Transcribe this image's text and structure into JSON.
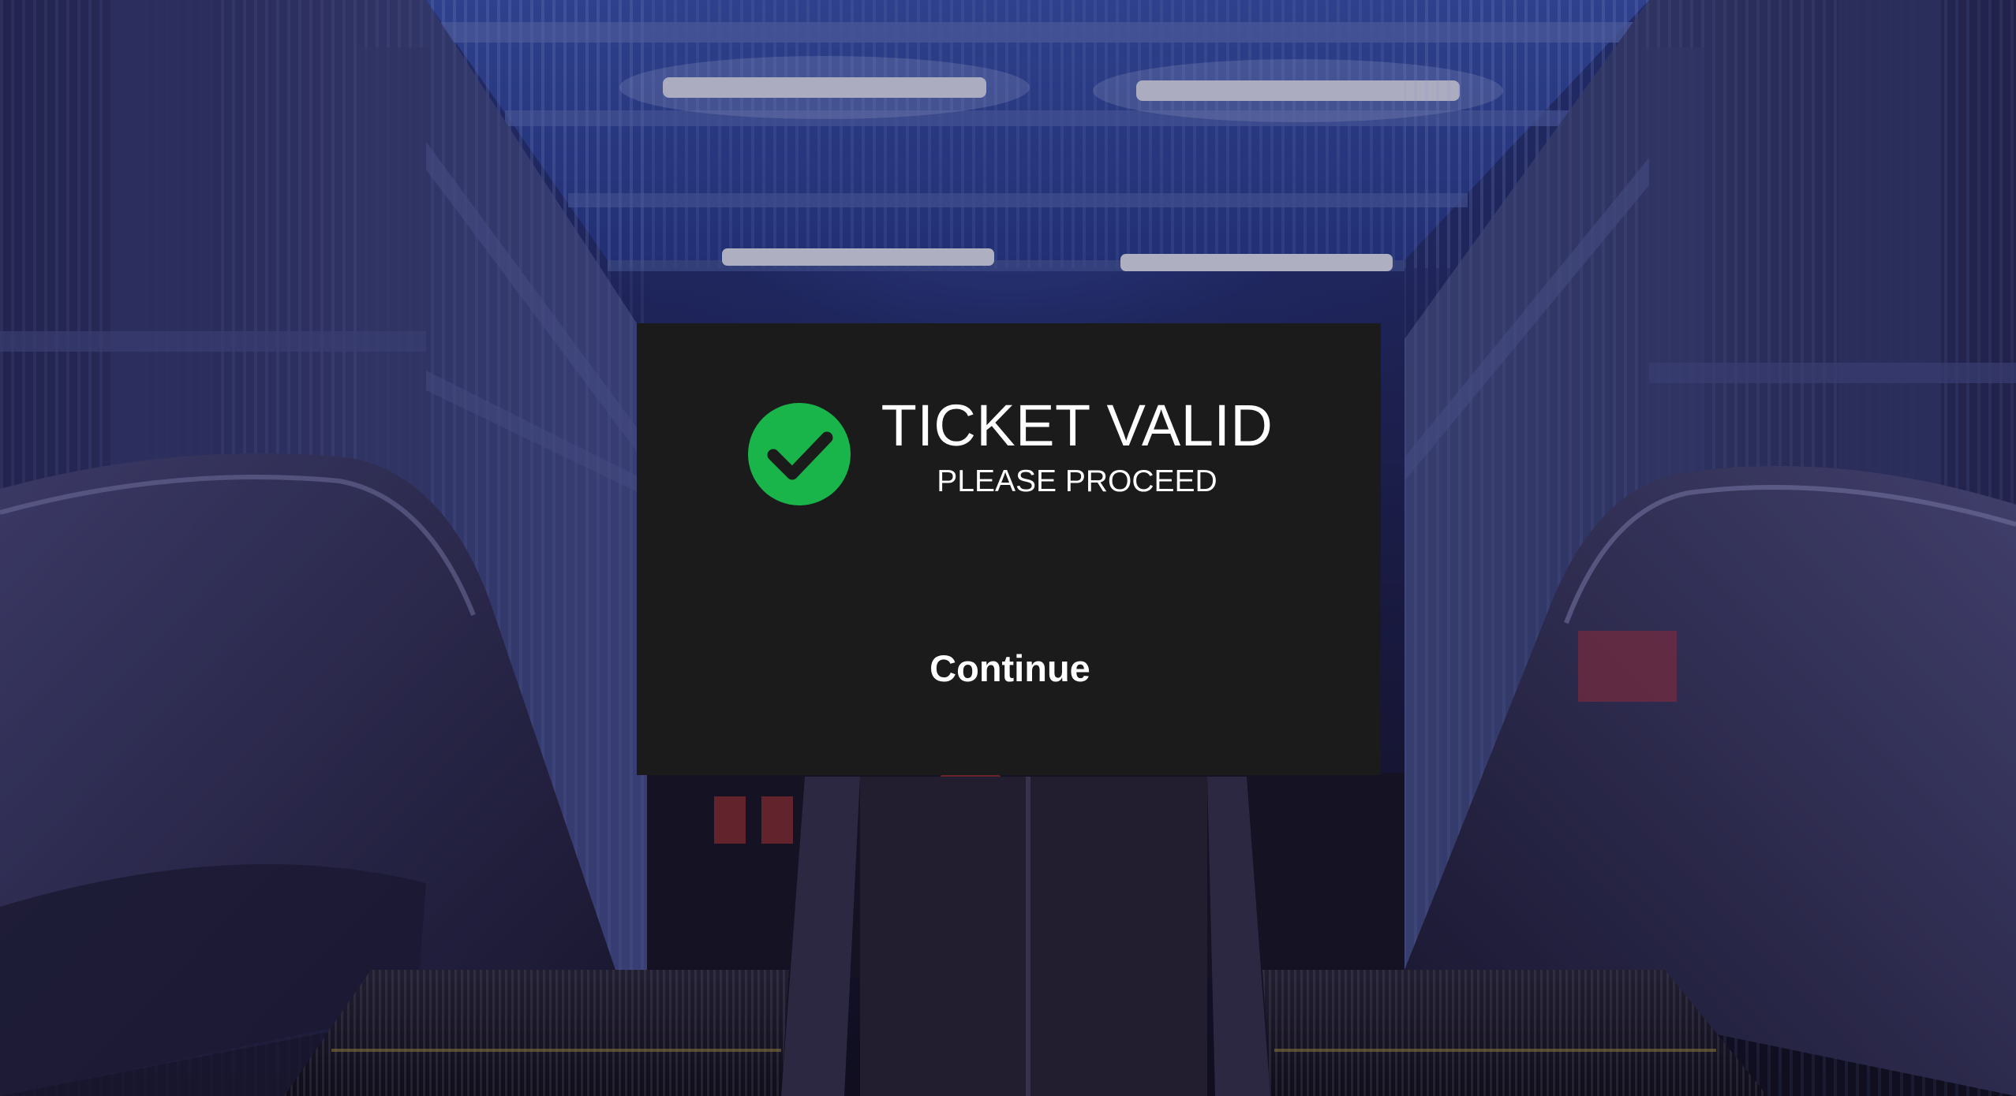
{
  "dialog": {
    "status_icon": "check-circle-icon",
    "title": "TICKET VALID",
    "subtitle": "PLEASE PROCEED",
    "continue_label": "Continue"
  },
  "colors": {
    "dialog_background": "#1b1b1b",
    "success": "#19b54b",
    "text": "#ffffff"
  }
}
